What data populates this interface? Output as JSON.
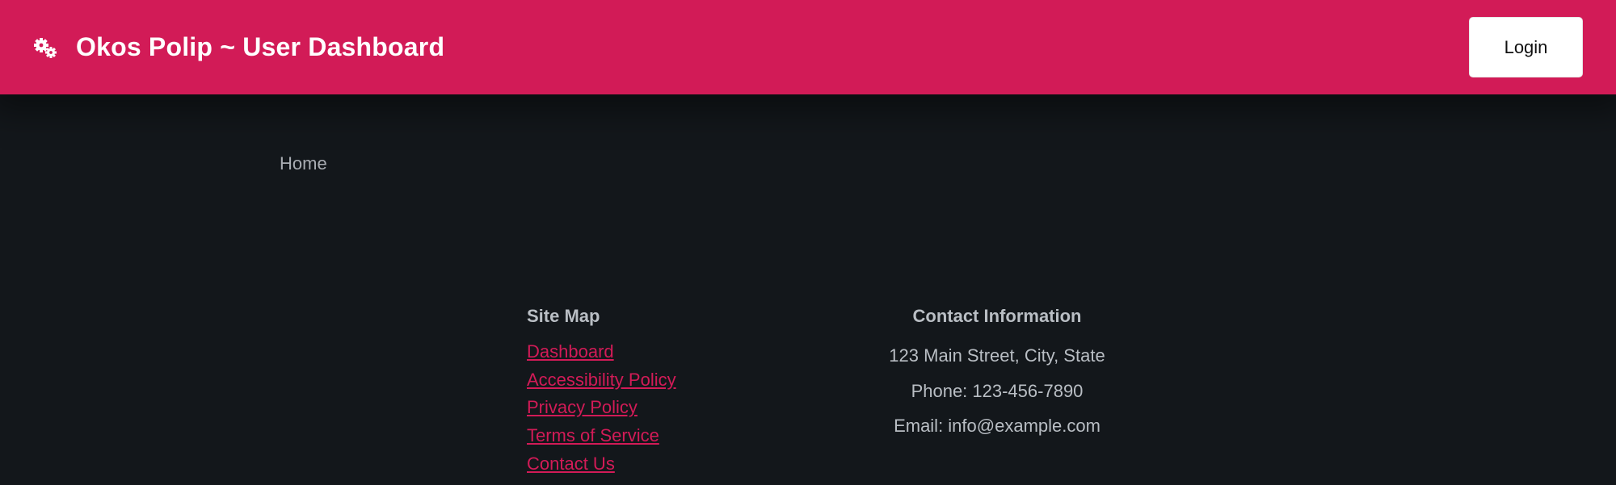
{
  "header": {
    "icon": "gears-icon",
    "title": "Okos Polip ~ User Dashboard",
    "login_label": "Login"
  },
  "breadcrumb": {
    "home": "Home"
  },
  "footer": {
    "sitemap": {
      "heading": "Site Map",
      "links": [
        "Dashboard",
        "Accessibility Policy",
        "Privacy Policy",
        "Terms of Service",
        "Contact Us"
      ]
    },
    "contact": {
      "heading": "Contact Information",
      "address": "123 Main Street, City, State",
      "phone": "Phone: 123-456-7890",
      "email": "Email: info@example.com"
    }
  },
  "colors": {
    "accent": "#d21b57",
    "background": "#13171b",
    "text_muted": "#b9bec4"
  }
}
